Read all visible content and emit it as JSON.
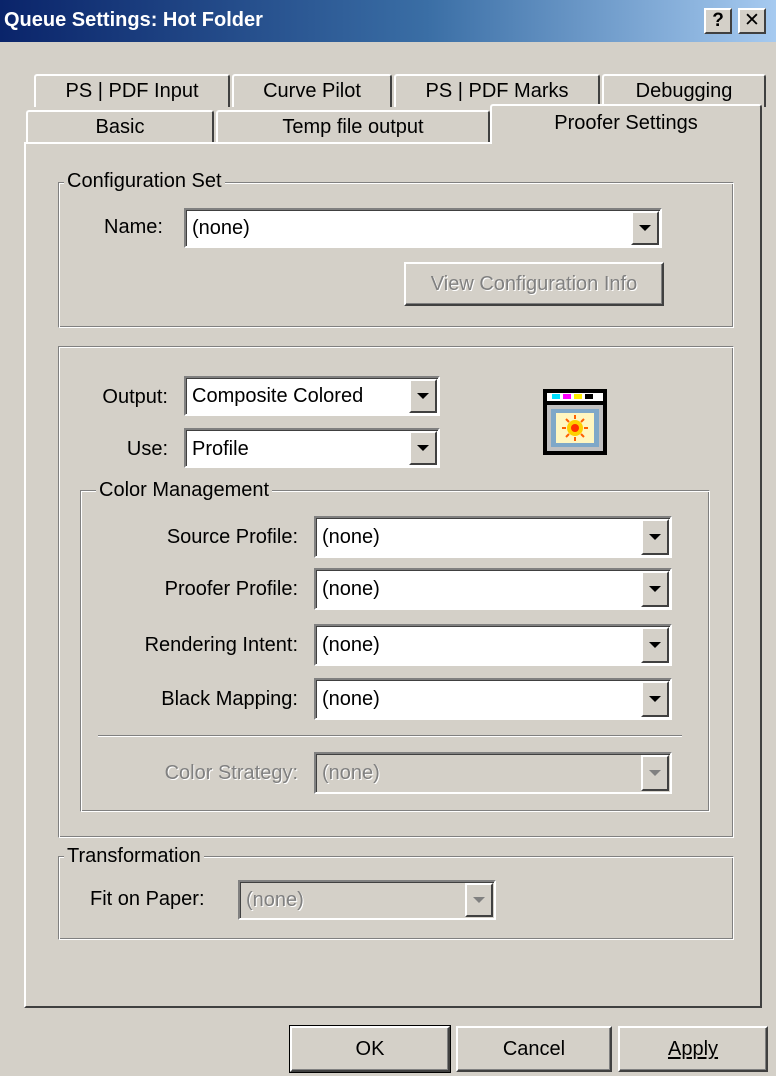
{
  "window": {
    "title": "Queue Settings: Hot Folder",
    "help_label": "?",
    "close_label": "✕"
  },
  "tabs": {
    "back_row": [
      "PS | PDF Input",
      "Curve Pilot",
      "PS | PDF Marks",
      "Debugging"
    ],
    "front_row": [
      "Basic",
      "Temp file output",
      "Proofer Settings"
    ],
    "active": "Proofer Settings"
  },
  "configuration_set": {
    "legend": "Configuration Set",
    "name_label": "Name:",
    "name_value": "(none)",
    "view_info_label": "View Configuration Info"
  },
  "output_section": {
    "output_label": "Output:",
    "output_value": "Composite Colored",
    "use_label": "Use:",
    "use_value": "Profile",
    "icon": "proofer-printer-icon"
  },
  "color_management": {
    "legend": "Color Management",
    "source_profile_label": "Source Profile:",
    "source_profile_value": "(none)",
    "proofer_profile_label": "Proofer Profile:",
    "proofer_profile_value": "(none)",
    "rendering_intent_label": "Rendering Intent:",
    "rendering_intent_value": "(none)",
    "black_mapping_label": "Black Mapping:",
    "black_mapping_value": "(none)",
    "color_strategy_label": "Color Strategy:",
    "color_strategy_value": "(none)"
  },
  "transformation": {
    "legend": "Transformation",
    "fit_label": "Fit on Paper:",
    "fit_value": "(none)"
  },
  "buttons": {
    "ok_label": "OK",
    "cancel_label": "Cancel",
    "apply_label": "Apply"
  },
  "colors": {
    "titlebar_start": "#0a246a",
    "titlebar_end": "#a6caf0",
    "face": "#d4d0c8"
  }
}
